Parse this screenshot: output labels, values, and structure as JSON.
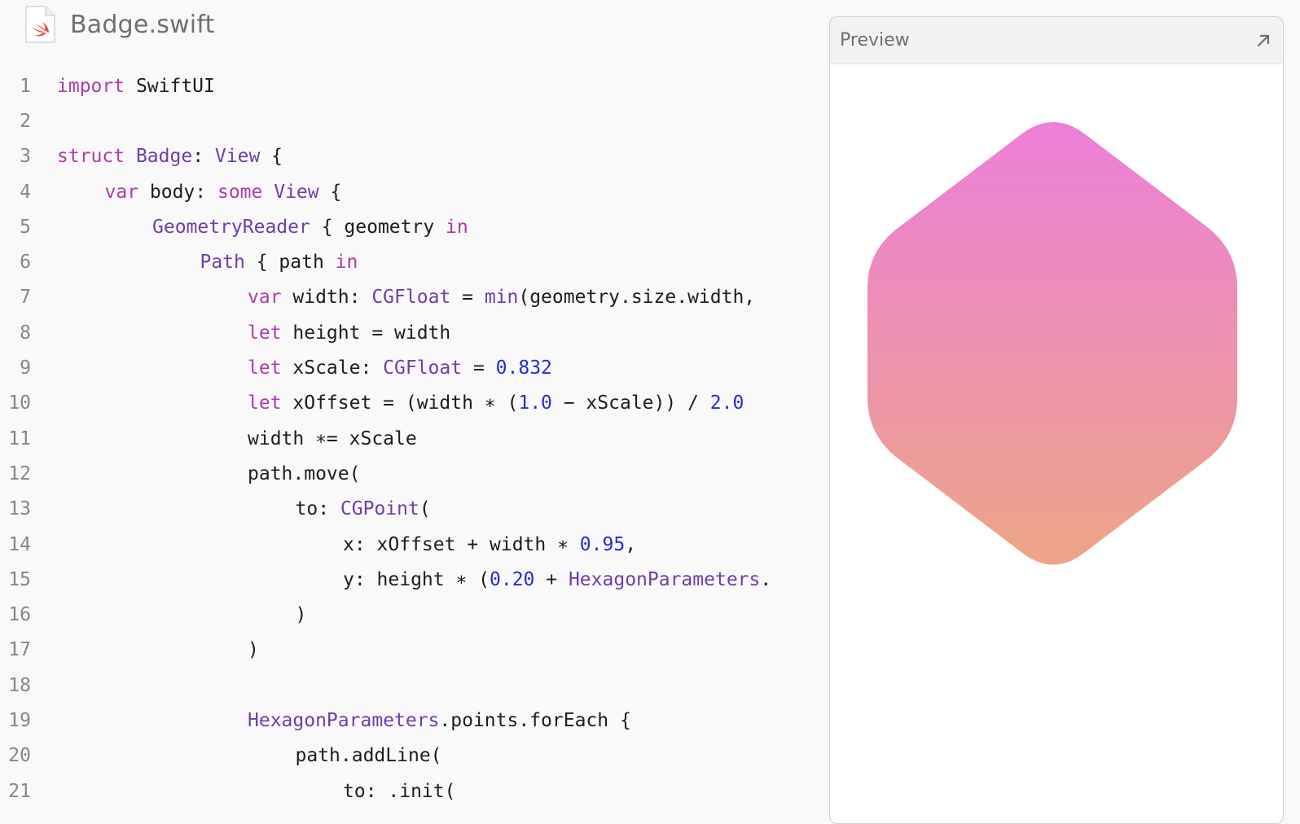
{
  "file": {
    "name": "Badge.swift",
    "icon": "swift-file-icon"
  },
  "preview": {
    "title": "Preview",
    "expand_icon": "expand-arrow-icon",
    "badge_gradient": {
      "top": "#ec7fd9",
      "bottom": "#eda586"
    }
  },
  "code_lines": [
    {
      "n": "1",
      "indent": 0,
      "tokens": [
        [
          "keyword",
          "import"
        ],
        [
          "plain",
          " SwiftUI"
        ]
      ]
    },
    {
      "n": "2",
      "indent": 0,
      "tokens": []
    },
    {
      "n": "3",
      "indent": 0,
      "tokens": [
        [
          "keyword",
          "struct"
        ],
        [
          "plain",
          " "
        ],
        [
          "type",
          "Badge"
        ],
        [
          "plain",
          ": "
        ],
        [
          "type",
          "View"
        ],
        [
          "plain",
          " {"
        ]
      ]
    },
    {
      "n": "4",
      "indent": 1,
      "tokens": [
        [
          "keyword",
          "var"
        ],
        [
          "plain",
          " body: "
        ],
        [
          "keyword",
          "some"
        ],
        [
          "plain",
          " "
        ],
        [
          "type",
          "View"
        ],
        [
          "plain",
          " {"
        ]
      ]
    },
    {
      "n": "5",
      "indent": 2,
      "tokens": [
        [
          "type",
          "GeometryReader"
        ],
        [
          "plain",
          " { geometry "
        ],
        [
          "keyword",
          "in"
        ]
      ]
    },
    {
      "n": "6",
      "indent": 3,
      "tokens": [
        [
          "type",
          "Path"
        ],
        [
          "plain",
          " { path "
        ],
        [
          "keyword",
          "in"
        ]
      ]
    },
    {
      "n": "7",
      "indent": 4,
      "tokens": [
        [
          "keyword",
          "var"
        ],
        [
          "plain",
          " width: "
        ],
        [
          "type",
          "CGFloat"
        ],
        [
          "plain",
          " = "
        ],
        [
          "type",
          "min"
        ],
        [
          "plain",
          "(geometry.size.width,"
        ]
      ]
    },
    {
      "n": "8",
      "indent": 4,
      "tokens": [
        [
          "keyword",
          "let"
        ],
        [
          "plain",
          " height = width"
        ]
      ]
    },
    {
      "n": "9",
      "indent": 4,
      "tokens": [
        [
          "keyword",
          "let"
        ],
        [
          "plain",
          " xScale: "
        ],
        [
          "type",
          "CGFloat"
        ],
        [
          "plain",
          " = "
        ],
        [
          "number",
          "0.832"
        ]
      ]
    },
    {
      "n": "10",
      "indent": 4,
      "tokens": [
        [
          "keyword",
          "let"
        ],
        [
          "plain",
          " xOffset = (width ∗ ("
        ],
        [
          "number",
          "1.0"
        ],
        [
          "plain",
          " − xScale)) / "
        ],
        [
          "number",
          "2.0"
        ]
      ]
    },
    {
      "n": "11",
      "indent": 4,
      "tokens": [
        [
          "plain",
          "width ∗= xScale"
        ]
      ]
    },
    {
      "n": "12",
      "indent": 4,
      "tokens": [
        [
          "plain",
          "path.move("
        ]
      ]
    },
    {
      "n": "13",
      "indent": 5,
      "tokens": [
        [
          "plain",
          "to: "
        ],
        [
          "type",
          "CGPoint"
        ],
        [
          "plain",
          "("
        ]
      ]
    },
    {
      "n": "14",
      "indent": 6,
      "tokens": [
        [
          "plain",
          "x: xOffset + width ∗ "
        ],
        [
          "number",
          "0.95"
        ],
        [
          "plain",
          ","
        ]
      ]
    },
    {
      "n": "15",
      "indent": 6,
      "tokens": [
        [
          "plain",
          "y: height ∗ ("
        ],
        [
          "number",
          "0.20"
        ],
        [
          "plain",
          " + "
        ],
        [
          "type",
          "HexagonParameters"
        ],
        [
          "plain",
          "."
        ]
      ]
    },
    {
      "n": "16",
      "indent": 5,
      "tokens": [
        [
          "plain",
          ")"
        ]
      ]
    },
    {
      "n": "17",
      "indent": 4,
      "tokens": [
        [
          "plain",
          ")"
        ]
      ]
    },
    {
      "n": "18",
      "indent": 0,
      "tokens": []
    },
    {
      "n": "19",
      "indent": 4,
      "tokens": [
        [
          "type",
          "HexagonParameters"
        ],
        [
          "plain",
          ".points.forEach {"
        ]
      ]
    },
    {
      "n": "20",
      "indent": 5,
      "tokens": [
        [
          "plain",
          "path.addLine("
        ]
      ]
    },
    {
      "n": "21",
      "indent": 6,
      "tokens": [
        [
          "plain",
          "to: .init("
        ]
      ]
    }
  ]
}
